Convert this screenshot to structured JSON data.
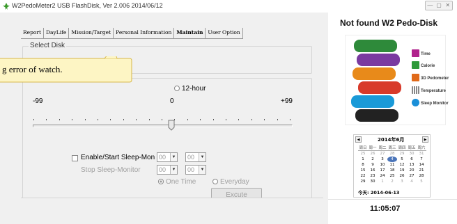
{
  "window": {
    "title": "W2PedoMeter2 USB FlashDisk, Ver 2.006   2014/06/12",
    "buttons": [
      "—",
      "▢",
      "✕"
    ]
  },
  "tabs": [
    {
      "label": "Report"
    },
    {
      "label": "DayLife"
    },
    {
      "label": "Mission/Target"
    },
    {
      "label": "Personal Information"
    },
    {
      "label": "Maintain",
      "active": true
    },
    {
      "label": "User Option"
    }
  ],
  "select_disk": {
    "label": "Select Disk"
  },
  "tooltip": {
    "text": "g error of watch."
  },
  "time_format": {
    "option_12": "12-hour"
  },
  "slider": {
    "min_label": "-99",
    "mid_label": "0",
    "max_label": "+99",
    "value": 0
  },
  "sleep": {
    "enable_label": "Enable/Start Sleep-Mon",
    "stop_label": "Stop Sleep-Monitor",
    "start_hour": "00",
    "start_min": "00",
    "stop_hour": "00",
    "stop_min": "00",
    "one_time_label": "One Time",
    "everyday_label": "Everyday",
    "execute_label": "Excute"
  },
  "right_panel": {
    "title": "Not found W2 Pedo-Disk",
    "legend": [
      {
        "label": "Time",
        "icon": "clock-icon",
        "color": "#b0228c"
      },
      {
        "label": "Calorie",
        "icon": "calorie-icon",
        "color": "#2e9a3a"
      },
      {
        "label": "3D Pedometer",
        "icon": "pedometer-icon",
        "color": "#e06a1a"
      },
      {
        "label": "Temperature",
        "icon": "thermometer-icon",
        "color": "#888888"
      },
      {
        "label": "Sleep Monitor",
        "icon": "sleep-icon",
        "color": "#1a8fd8"
      }
    ],
    "clock": "11:05:07"
  },
  "calendar": {
    "month_label": "2014年6月",
    "weekdays": [
      "周日",
      "周一",
      "周二",
      "周三",
      "周四",
      "周五",
      "周六"
    ],
    "weeks": [
      [
        "25",
        "26",
        "27",
        "28",
        "29",
        "30",
        "31"
      ],
      [
        "1",
        "2",
        "3",
        "4",
        "5",
        "6",
        "7"
      ],
      [
        "8",
        "9",
        "10",
        "11",
        "12",
        "13",
        "14"
      ],
      [
        "15",
        "16",
        "17",
        "18",
        "19",
        "20",
        "21"
      ],
      [
        "22",
        "23",
        "24",
        "25",
        "26",
        "27",
        "28"
      ],
      [
        "29",
        "30",
        "1",
        "2",
        "3",
        "4",
        "5"
      ]
    ],
    "today_label": "今天: 2014-06-13",
    "today_day": "4",
    "prev": "◀",
    "next": "▶"
  }
}
